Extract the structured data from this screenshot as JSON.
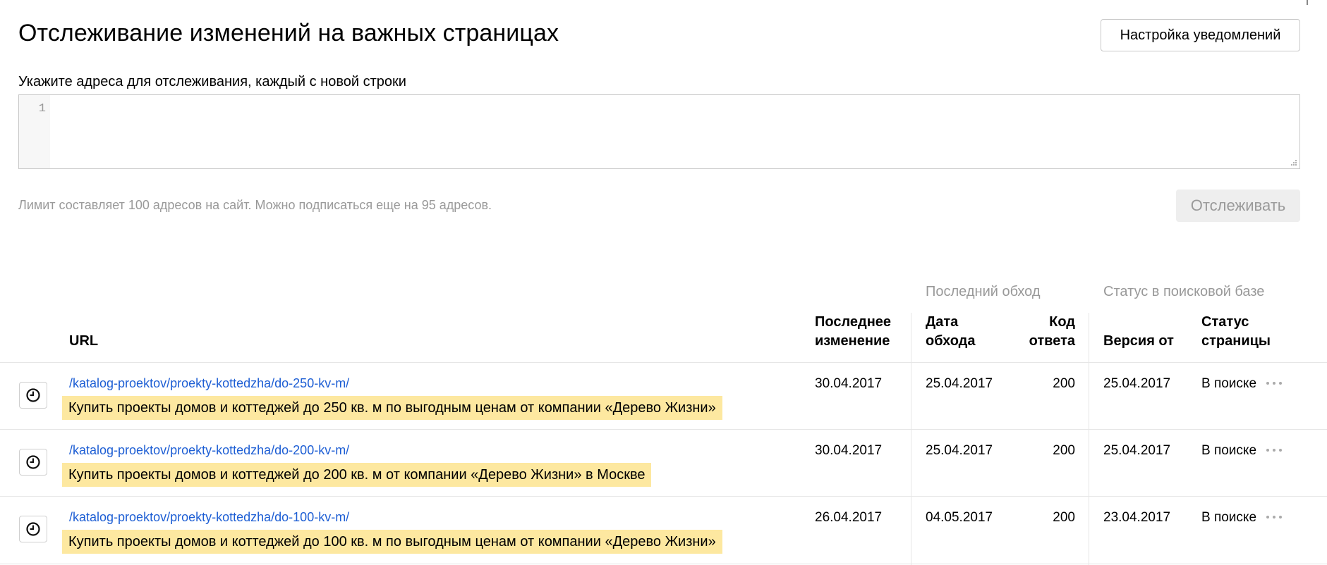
{
  "page": {
    "title": "Отслеживание изменений на важных страницах",
    "notify_button": "Настройка уведомлений"
  },
  "form": {
    "label": "Укажите адреса для отслеживания, каждый с новой строки",
    "line_number": "1",
    "limit_text": "Лимит составляет 100 адресов на сайт. Можно подписаться еще на 95 адресов.",
    "submit_label": "Отслеживать"
  },
  "table": {
    "groups": {
      "last_crawl": "Последний обход",
      "search_status": "Статус в поисковой базе"
    },
    "columns": {
      "url": "URL",
      "last_change_1": "Последнее",
      "last_change_2": "изменение",
      "crawl_date_1": "Дата",
      "crawl_date_2": "обхода",
      "code_1": "Код",
      "code_2": "ответа",
      "version": "Версия от",
      "status_1": "Статус",
      "status_2": "страницы"
    },
    "rows": [
      {
        "url": "/katalog-proektov/proekty-kottedzha/do-250-kv-m/",
        "title": "Купить проекты домов и коттеджей до 250 кв. м по выгодным ценам от компании «Дерево Жизни»",
        "last_change": "30.04.2017",
        "crawl_date": "25.04.2017",
        "code": "200",
        "version": "25.04.2017",
        "status": "В поиске"
      },
      {
        "url": "/katalog-proektov/proekty-kottedzha/do-200-kv-m/",
        "title": "Купить проекты домов и коттеджей до 200 кв. м от компании «Дерево Жизни» в Москве",
        "last_change": "30.04.2017",
        "crawl_date": "25.04.2017",
        "code": "200",
        "version": "25.04.2017",
        "status": "В поиске"
      },
      {
        "url": "/katalog-proektov/proekty-kottedzha/do-100-kv-m/",
        "title": "Купить проекты домов и коттеджей до 100 кв. м по выгодным ценам от компании «Дерево Жизни»",
        "last_change": "26.04.2017",
        "crawl_date": "04.05.2017",
        "code": "200",
        "version": "23.04.2017",
        "status": "В поиске"
      }
    ]
  },
  "colors": {
    "link": "#1d5ed4",
    "title_highlight": "#fde8a0",
    "muted_text": "#999999",
    "divider": "#e6e6e6"
  },
  "icons": {
    "history": "clock-icon",
    "more": "more-dots-icon"
  }
}
